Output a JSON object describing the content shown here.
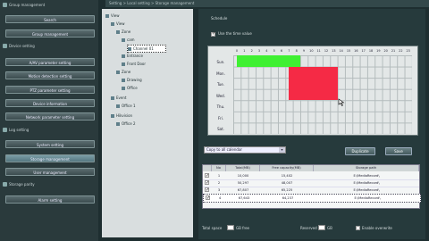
{
  "nav": {
    "sections": [
      {
        "label": "Group management"
      },
      {
        "label": "Device setting"
      },
      {
        "label": "Log setting"
      },
      {
        "label": "Storage parity"
      }
    ],
    "buttons": [
      {
        "label": "Search"
      },
      {
        "label": "Group management"
      },
      {
        "label": "A/AV parameter setting"
      },
      {
        "label": "Motion detection setting"
      },
      {
        "label": "PTZ parameter setting"
      },
      {
        "label": "Device information"
      },
      {
        "label": "Network parameter setting"
      },
      {
        "label": "System setting"
      },
      {
        "label": "Storage management"
      },
      {
        "label": "User management"
      },
      {
        "label": "Alarm setting"
      }
    ],
    "active_index": 8
  },
  "breadcrumb": "Setting > Local setting > Storage management",
  "tree": [
    {
      "label": "View",
      "level": 0
    },
    {
      "label": "View",
      "level": 1
    },
    {
      "label": "Zone",
      "level": 2
    },
    {
      "label": "cam",
      "level": 3
    },
    {
      "label": "Channel 01",
      "level": 4,
      "selected": true
    },
    {
      "label": "Entrance",
      "level": 3
    },
    {
      "label": "Front Door",
      "level": 3
    },
    {
      "label": "Zone",
      "level": 2
    },
    {
      "label": "Drawing",
      "level": 3
    },
    {
      "label": "Office",
      "level": 3
    },
    {
      "label": "Event",
      "level": 1
    },
    {
      "label": "Office 1",
      "level": 2
    },
    {
      "label": "Hikvision",
      "level": 1
    },
    {
      "label": "Office 2",
      "level": 2
    }
  ],
  "panel": {
    "schedule_title": "Schedule",
    "enable_label": "Use the time value",
    "enable_checked": true,
    "hours": [
      "0",
      "1",
      "2",
      "3",
      "4",
      "5",
      "6",
      "7",
      "8",
      "9",
      "10",
      "11",
      "12",
      "13",
      "14",
      "15",
      "16",
      "17",
      "18",
      "19",
      "20",
      "21",
      "22",
      "23"
    ],
    "days": [
      "Sun.",
      "Mon.",
      "Tue.",
      "Wed.",
      "Thu.",
      "Fri.",
      "Sat."
    ],
    "blocks": [
      {
        "day_start": 0,
        "day_end": 1,
        "hour_start": 0.5,
        "hour_end": 9,
        "color": "#3ff032"
      },
      {
        "day_start": 1,
        "day_end": 4,
        "hour_start": 7.4,
        "hour_end": 14,
        "color": "#f52a45"
      }
    ],
    "copy_select": "Copy to all calendar",
    "duplicate_label": "Duplicate",
    "save_label": "Save",
    "table": {
      "headers": [
        "No",
        "Total(MB)",
        "Free capacity(MB)",
        "Storage path"
      ],
      "rows": [
        {
          "checked": true,
          "no": "1",
          "total": "10,000",
          "free": "15,402",
          "path": "E:\\MediaRecord\\"
        },
        {
          "checked": true,
          "no": "2",
          "total": "50,297",
          "free": "48,007",
          "path": "E:\\MediaRecord\\"
        },
        {
          "checked": true,
          "no": "3",
          "total": "67,807",
          "free": "65,225",
          "path": "E:\\MediaRecord\\"
        },
        {
          "checked": true,
          "no": "4",
          "total": "67,643",
          "free": "64,237",
          "path": "E:\\MediaRecord\\",
          "selected": true
        }
      ]
    },
    "bottom": {
      "left_label": "Total space",
      "left_unit": "GB free",
      "right_label": "Reserved",
      "right_unit": "GB",
      "check_label": "Enable overwrite"
    }
  }
}
